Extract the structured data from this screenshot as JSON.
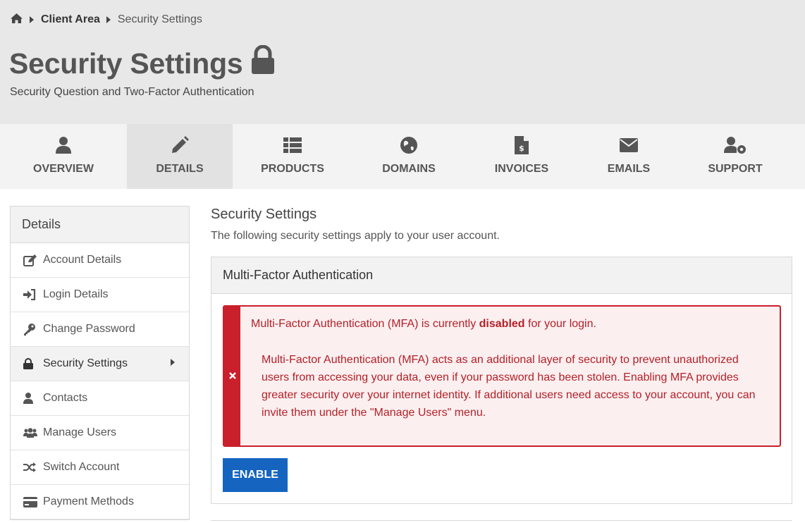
{
  "breadcrumb": {
    "home_icon": "home-icon",
    "items": [
      "Client Area",
      "Security Settings"
    ]
  },
  "header": {
    "title": "Security Settings",
    "title_icon": "lock-icon",
    "subtitle": "Security Question and Two-Factor Authentication"
  },
  "tabs": [
    {
      "label": "OVERVIEW",
      "icon": "user-icon",
      "active": false
    },
    {
      "label": "DETAILS",
      "icon": "pencil-icon",
      "active": true
    },
    {
      "label": "PRODUCTS",
      "icon": "list-icon",
      "active": false
    },
    {
      "label": "DOMAINS",
      "icon": "globe-icon",
      "active": false
    },
    {
      "label": "INVOICES",
      "icon": "invoice-icon",
      "active": false
    },
    {
      "label": "EMAILS",
      "icon": "envelope-icon",
      "active": false
    },
    {
      "label": "SUPPORT",
      "icon": "user-gear-icon",
      "active": false
    }
  ],
  "sidebar": {
    "title": "Details",
    "items": [
      {
        "label": "Account Details",
        "icon": "edit-icon"
      },
      {
        "label": "Login Details",
        "icon": "sign-in-icon"
      },
      {
        "label": "Change Password",
        "icon": "key-icon"
      },
      {
        "label": "Security Settings",
        "icon": "lock-icon",
        "active": true
      },
      {
        "label": "Contacts",
        "icon": "user-icon"
      },
      {
        "label": "Manage Users",
        "icon": "users-icon"
      },
      {
        "label": "Switch Account",
        "icon": "shuffle-icon"
      },
      {
        "label": "Payment Methods",
        "icon": "credit-card-icon"
      }
    ]
  },
  "main": {
    "title": "Security Settings",
    "description": "The following security settings apply to your user account.",
    "card": {
      "title": "Multi-Factor Authentication",
      "alert": {
        "line_prefix": "Multi-Factor Authentication (MFA) is currently ",
        "line_status": "disabled",
        "line_suffix": " for your login.",
        "paragraph": "Multi-Factor Authentication (MFA) acts as an additional layer of security to prevent unauthorized users from accessing your data, even if your password has been stolen. Enabling MFA provides greater security over your internet identity. If additional users need access to your account, you can invite them under the \"Manage Users\" menu.",
        "icon": "close-icon"
      },
      "button_label": "ENABLE"
    }
  },
  "colors": {
    "alert_red": "#c9202c",
    "alert_bg": "#fbeff0",
    "button_blue": "#1565c0"
  }
}
